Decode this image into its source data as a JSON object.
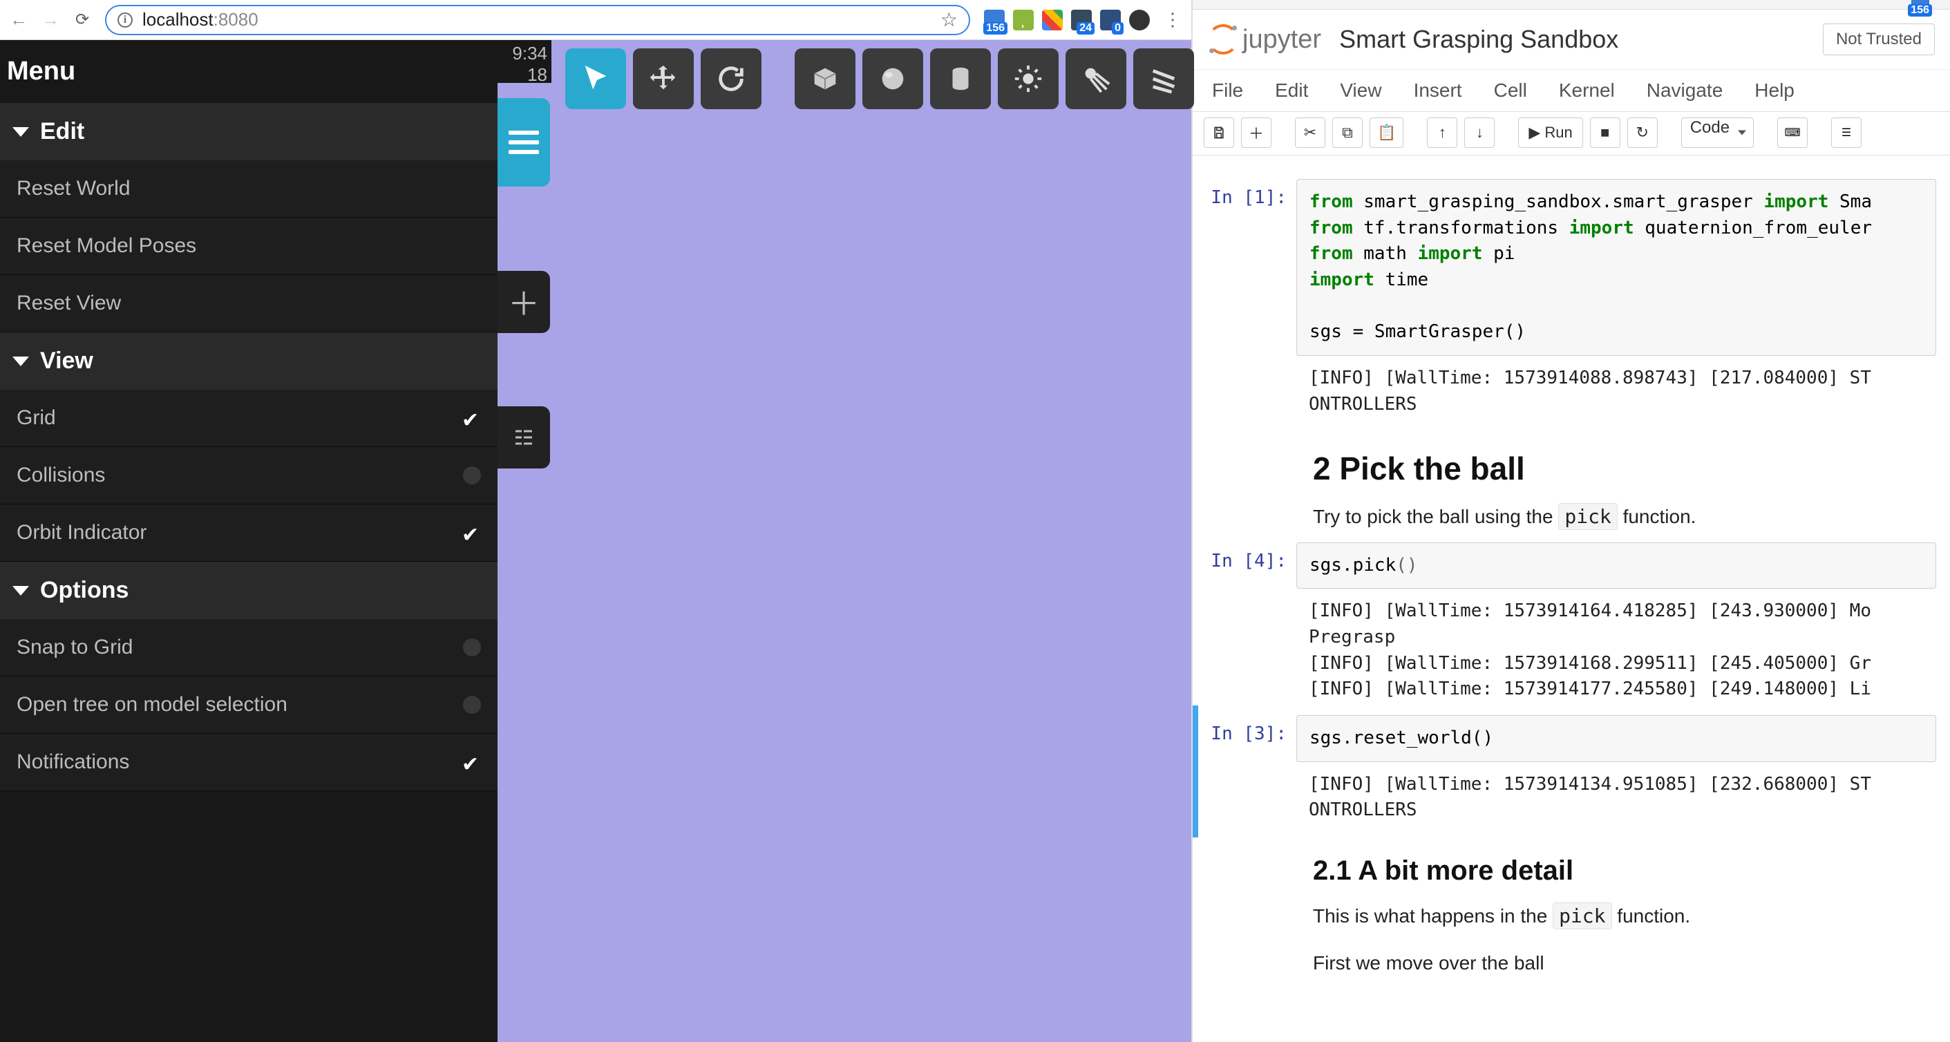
{
  "left_browser": {
    "url_host": "localhost",
    "url_port": ":8080",
    "ext_badges": {
      "a": "156",
      "b": "24",
      "c": "0"
    }
  },
  "sidebar": {
    "title": "Menu",
    "sections": [
      {
        "label": "Edit",
        "items": [
          {
            "label": "Reset World",
            "toggle": null
          },
          {
            "label": "Reset Model Poses",
            "toggle": null
          },
          {
            "label": "Reset View",
            "toggle": null
          }
        ]
      },
      {
        "label": "View",
        "items": [
          {
            "label": "Grid",
            "toggle": true
          },
          {
            "label": "Collisions",
            "toggle": false
          },
          {
            "label": "Orbit Indicator",
            "toggle": true
          }
        ]
      },
      {
        "label": "Options",
        "items": [
          {
            "label": "Snap to Grid",
            "toggle": false
          },
          {
            "label": "Open tree on model selection",
            "toggle": false
          },
          {
            "label": "Notifications",
            "toggle": true
          }
        ]
      }
    ]
  },
  "viewport": {
    "time_top": "9:34",
    "time_bottom": "18",
    "tools": [
      "pointer",
      "move",
      "rotate",
      "box",
      "sphere",
      "cylinder",
      "light-point",
      "light-spot",
      "light-directional"
    ]
  },
  "right_browser": {
    "ext_badge": "156"
  },
  "jupyter": {
    "logo_text": "jupyter",
    "title": "Smart Grasping Sandbox",
    "trusted": "Not Trusted",
    "menus": [
      "File",
      "Edit",
      "View",
      "Insert",
      "Cell",
      "Kernel",
      "Navigate",
      "Help"
    ],
    "run_label": "Run",
    "celltype": "Code",
    "cells": [
      {
        "prompt": "In [1]:",
        "type": "code",
        "code_html": "<span class='kw-green'>from</span> smart_grasping_sandbox.smart_grasper <span class='kw-green'>import</span> Sma\n<span class='kw-green'>from</span> tf.transformations <span class='kw-green'>import</span> quaternion_from_euler\n<span class='kw-green'>from</span> math <span class='kw-green'>import</span> pi\n<span class='kw-green'>import</span> time\n\nsgs = SmartGrasper()",
        "output": "[INFO] [WallTime: 1573914088.898743] [217.084000] ST\nONTROLLERS"
      },
      {
        "type": "md",
        "h": "2  Pick the ball",
        "p_before": "Try to pick the ball using the ",
        "code_inline": "pick",
        "p_after": " function."
      },
      {
        "prompt": "In [4]:",
        "type": "code",
        "code_html": "sgs.pick<span class='paren'>()</span>",
        "output": "[INFO] [WallTime: 1573914164.418285] [243.930000] Mo\nPregrasp\n[INFO] [WallTime: 1573914168.299511] [245.405000] Gr\n[INFO] [WallTime: 1573914177.245580] [249.148000] Li"
      },
      {
        "prompt": "In [3]:",
        "type": "code",
        "selected": true,
        "code_html": "sgs.reset_world()",
        "output": "[INFO] [WallTime: 1573914134.951085] [232.668000] ST\nONTROLLERS"
      },
      {
        "type": "md",
        "h3": "2.1  A bit more detail",
        "p_before": "This is what happens in the ",
        "code_inline": "pick",
        "p_after": " function.",
        "p2": "First we move over the ball"
      }
    ]
  }
}
